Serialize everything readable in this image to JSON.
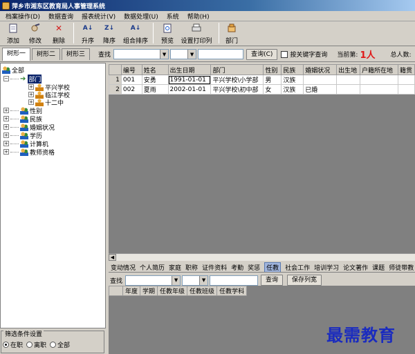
{
  "window": {
    "title": "萍乡市湘东区教育局人事管理系统"
  },
  "menu": [
    "档案操作(D)",
    "数据查询",
    "报表统计(V)",
    "数据处理(U)",
    "系统",
    "帮助(H)"
  ],
  "toolbar": {
    "add": "添加",
    "edit": "修改",
    "delete": "删除",
    "asc": "升序",
    "desc": "降序",
    "combo_sort": "组合排序",
    "preview": "预览",
    "print_cols": "设置打印列",
    "dept": "部门"
  },
  "tree_tabs": [
    "树形一",
    "树形二",
    "树形三"
  ],
  "search": {
    "label": "查找",
    "query_btn": "查询(C)",
    "keyword_label": "按关键字查询",
    "current_label": "当前第:",
    "current_value": "1人",
    "total_label": "总人数:"
  },
  "tree": {
    "root": "全部",
    "dept": "部门",
    "schools": [
      "平兴学校",
      "临江学校",
      "十二中"
    ],
    "groups": [
      "性别",
      "民族",
      "婚姻状况",
      "学历",
      "计算机",
      "教师资格"
    ]
  },
  "filter": {
    "title": "筛选条件设置",
    "options": [
      "在职",
      "离职",
      "全部"
    ],
    "selected": "在职"
  },
  "grid": {
    "columns": [
      "编号",
      "姓名",
      "出生日期",
      "部门",
      "性别",
      "民族",
      "婚姻状况",
      "出生地",
      "户籍所在地",
      "籍贯"
    ],
    "rows": [
      {
        "n": "1",
        "cells": [
          "001",
          "安勇",
          "1991-01-01",
          "平兴学校\\小学部",
          "男",
          "汉族",
          "",
          "",
          "",
          ""
        ]
      },
      {
        "n": "2",
        "cells": [
          "002",
          "夏雨",
          "2002-01-01",
          "平兴学校\\初中部",
          "女",
          "汉族",
          "已婚",
          "",
          "",
          ""
        ]
      }
    ]
  },
  "detail_tabs": [
    "变动情况",
    "个人简历",
    "家庭",
    "职称",
    "证件资料",
    "考勤",
    "奖惩",
    "任教",
    "社会工作",
    "培训学习",
    "论文著作",
    "课题",
    "师徒带教"
  ],
  "detail_active": "任教",
  "detail_search": {
    "label": "查找",
    "query_btn": "查询",
    "save_btn": "保存列宽"
  },
  "detail_grid": {
    "columns": [
      "年度",
      "学期",
      "任教年级",
      "任教班级",
      "任教学科"
    ]
  },
  "watermark": "最需教育"
}
